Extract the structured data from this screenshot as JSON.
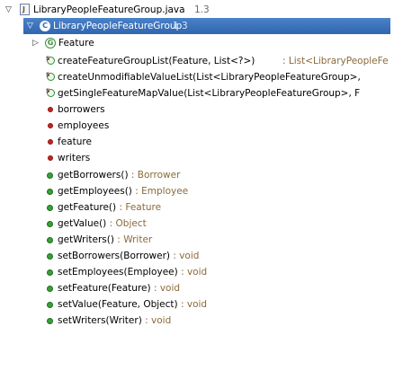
{
  "file": {
    "name": "LibraryPeopleFeatureGroup.java",
    "version": "1.3"
  },
  "selected_type": {
    "name": "LibraryPeopleFeatureGroup",
    "version": "1.3"
  },
  "nested_class": {
    "name": "Feature"
  },
  "static_methods": [
    {
      "name": "createFeatureGroupList(Feature, List<?>)",
      "ret": "List<LibraryPeopleFe"
    },
    {
      "name": "createUnmodifiableValueList(List<LibraryPeopleFeatureGroup>,",
      "ret": ""
    },
    {
      "name": "getSingleFeatureMapValue(List<LibraryPeopleFeatureGroup>, F",
      "ret": ""
    }
  ],
  "fields": [
    {
      "name": "borrowers"
    },
    {
      "name": "employees"
    },
    {
      "name": "feature"
    },
    {
      "name": "writers"
    }
  ],
  "methods": [
    {
      "name": "getBorrowers()",
      "ret": "Borrower"
    },
    {
      "name": "getEmployees()",
      "ret": "Employee"
    },
    {
      "name": "getFeature()",
      "ret": "Feature"
    },
    {
      "name": "getValue()",
      "ret": "Object"
    },
    {
      "name": "getWriters()",
      "ret": "Writer"
    },
    {
      "name": "setBorrowers(Borrower)",
      "ret": "void"
    },
    {
      "name": "setEmployees(Employee)",
      "ret": "void"
    },
    {
      "name": "setFeature(Feature)",
      "ret": "void"
    },
    {
      "name": "setValue(Feature, Object)",
      "ret": "void"
    },
    {
      "name": "setWriters(Writer)",
      "ret": "void"
    }
  ],
  "return_separator": ":"
}
